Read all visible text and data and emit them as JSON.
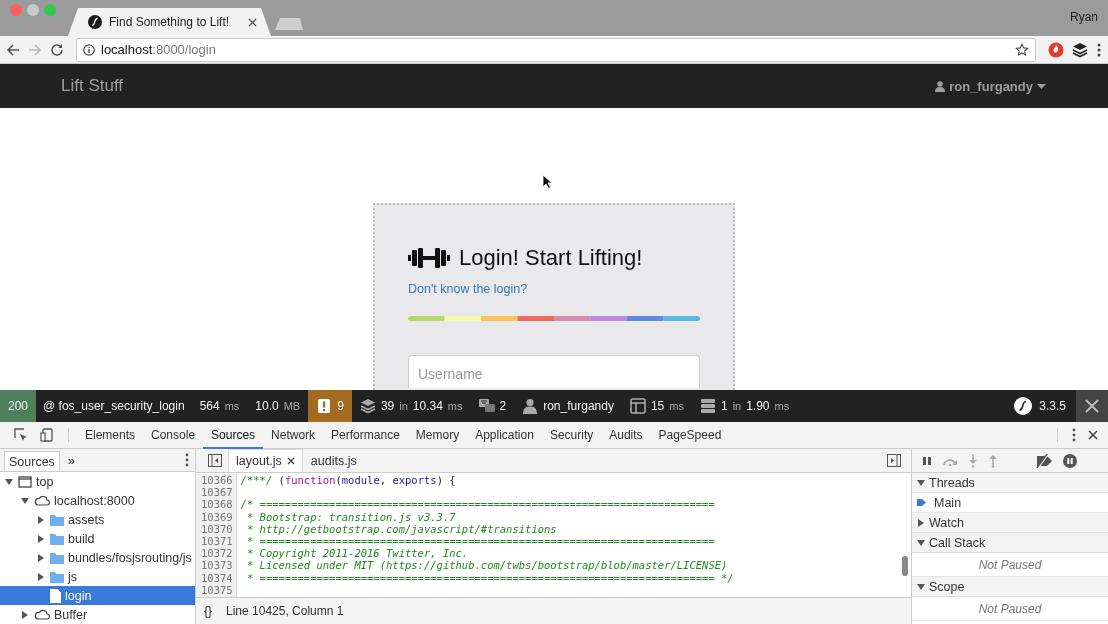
{
  "browser": {
    "tab": {
      "title": "Find Something to Lift!",
      "selected": true
    },
    "profile_name": "Ryan",
    "url": {
      "host": "localhost",
      "path": ":8000/login"
    }
  },
  "navbar": {
    "brand": "Lift Stuff",
    "user": "ron_furgandy"
  },
  "login": {
    "heading": "Login! Start Lifting!",
    "help_link": "Don't know the login?",
    "username": {
      "placeholder": "Username"
    }
  },
  "profiler": {
    "items": [
      {
        "kind": "status",
        "parts": [
          {
            "text": "200",
            "unit": false
          }
        ]
      },
      {
        "kind": "route",
        "parts": [
          {
            "text": "@ fos_user_security_login",
            "unit": false
          }
        ]
      },
      {
        "kind": "time",
        "parts": [
          {
            "text": "564",
            "unit": false
          },
          {
            "text": "ms",
            "unit": true
          }
        ]
      },
      {
        "kind": "memory",
        "parts": [
          {
            "text": "10.0",
            "unit": false
          },
          {
            "text": "MB",
            "unit": true
          }
        ]
      },
      {
        "kind": "warnings",
        "parts": [
          {
            "text": "9",
            "unit": false
          }
        ]
      },
      {
        "kind": "queries",
        "parts": [
          {
            "text": "39",
            "unit": false
          },
          {
            "text": "in",
            "unit": true
          },
          {
            "text": "10.34",
            "unit": false
          },
          {
            "text": "ms",
            "unit": true
          }
        ]
      },
      {
        "kind": "translations",
        "parts": [
          {
            "text": "2",
            "unit": false
          }
        ]
      },
      {
        "kind": "user",
        "parts": [
          {
            "text": "ron_furgandy",
            "unit": false
          }
        ]
      },
      {
        "kind": "templates",
        "parts": [
          {
            "text": "15",
            "unit": false
          },
          {
            "text": "ms",
            "unit": true
          }
        ]
      },
      {
        "kind": "cache",
        "parts": [
          {
            "text": "1",
            "unit": false
          },
          {
            "text": "in",
            "unit": true
          },
          {
            "text": "1.90",
            "unit": false
          },
          {
            "text": "ms",
            "unit": true
          }
        ]
      }
    ],
    "version": "3.3.5"
  },
  "devtools": {
    "tabs": [
      {
        "label": "Elements",
        "selected": false
      },
      {
        "label": "Console",
        "selected": false
      },
      {
        "label": "Sources",
        "selected": true
      },
      {
        "label": "Network",
        "selected": false
      },
      {
        "label": "Performance",
        "selected": false
      },
      {
        "label": "Memory",
        "selected": false
      },
      {
        "label": "Application",
        "selected": false
      },
      {
        "label": "Security",
        "selected": false
      },
      {
        "label": "Audits",
        "selected": false
      },
      {
        "label": "PageSpeed",
        "selected": false
      }
    ],
    "navigator": {
      "tabs": [
        {
          "label": "Sources",
          "selected": true
        }
      ],
      "more": "»",
      "tree": [
        {
          "label": "top",
          "kind": "frame",
          "expanded": true,
          "selected": false,
          "children": [
            {
              "label": "localhost:8000",
              "kind": "domain",
              "expanded": true,
              "selected": false,
              "children": [
                {
                  "label": "assets",
                  "kind": "folder",
                  "expanded": false,
                  "selected": false
                },
                {
                  "label": "build",
                  "kind": "folder",
                  "expanded": false,
                  "selected": false
                },
                {
                  "label": "bundles/fosjsrouting/js",
                  "kind": "folder",
                  "expanded": false,
                  "selected": false
                },
                {
                  "label": "js",
                  "kind": "folder",
                  "expanded": false,
                  "selected": false
                },
                {
                  "label": "login",
                  "kind": "file",
                  "selected": true
                }
              ]
            },
            {
              "label": "Buffer",
              "kind": "domain",
              "expanded": false,
              "selected": false
            }
          ]
        }
      ]
    },
    "editor": {
      "tabs": [
        {
          "label": "layout.js",
          "selected": true,
          "closable": true
        },
        {
          "label": "audits.js",
          "selected": false,
          "closable": false
        }
      ],
      "lines": [
        {
          "number": "10366",
          "tokens": [
            {
              "kind": "comment",
              "text": "/***/"
            },
            {
              "kind": "plain",
              "text": " ("
            },
            {
              "kind": "keyword",
              "text": "function"
            },
            {
              "kind": "plain",
              "text": "("
            },
            {
              "kind": "variable",
              "text": "module"
            },
            {
              "kind": "plain",
              "text": ", "
            },
            {
              "kind": "variable",
              "text": "exports"
            },
            {
              "kind": "plain",
              "text": ") {"
            }
          ]
        },
        {
          "number": "10367"
        },
        {
          "number": "10368",
          "tokens": [
            {
              "kind": "comment",
              "text": "/* ========================================================================"
            }
          ]
        },
        {
          "number": "10369",
          "tokens": [
            {
              "kind": "comment",
              "text": " * Bootstrap: transition.js v3.3.7"
            }
          ]
        },
        {
          "number": "10370",
          "tokens": [
            {
              "kind": "comment",
              "text": " * http://getbootstrap.com/javascript/#transitions"
            }
          ]
        },
        {
          "number": "10371",
          "tokens": [
            {
              "kind": "comment",
              "text": " * ========================================================================"
            }
          ]
        },
        {
          "number": "10372",
          "tokens": [
            {
              "kind": "comment",
              "text": " * Copyright 2011-2016 Twitter, Inc."
            }
          ]
        },
        {
          "number": "10373",
          "tokens": [
            {
              "kind": "comment",
              "text": " * Licensed under MIT (https://github.com/twbs/bootstrap/blob/master/LICENSE)"
            }
          ]
        },
        {
          "number": "10374",
          "tokens": [
            {
              "kind": "comment",
              "text": " * ======================================================================== */"
            }
          ]
        },
        {
          "number": "10375"
        }
      ],
      "status": {
        "format": "{}",
        "position": "Line 10425, Column 1"
      }
    },
    "debugger": {
      "sections": [
        {
          "title": "Threads",
          "expanded": true,
          "items": [
            {
              "kind": "thread",
              "label": "Main",
              "current": true
            }
          ]
        },
        {
          "title": "Watch",
          "expanded": false
        },
        {
          "title": "Call Stack",
          "expanded": true,
          "items": [
            {
              "kind": "message",
              "label": "Not Paused"
            }
          ]
        },
        {
          "title": "Scope",
          "expanded": true,
          "items": [
            {
              "kind": "message",
              "label": "Not Paused"
            }
          ]
        }
      ]
    }
  }
}
